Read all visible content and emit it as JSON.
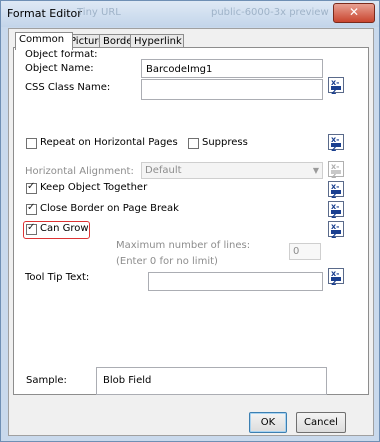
{
  "window": {
    "title": "Format Editor",
    "close_glyph": "✕",
    "background_title_fragments": [
      "Tiny URL",
      "public-6000-3x preview"
    ]
  },
  "tabs": [
    {
      "label": "Common",
      "active": true
    },
    {
      "label": "Picture",
      "active": false
    },
    {
      "label": "Border",
      "active": false
    },
    {
      "label": "Hyperlink",
      "active": false
    }
  ],
  "common": {
    "section_label": "Object format:",
    "object_name_label": "Object Name:",
    "object_name_value": "BarcodeImg1",
    "css_class_label": "CSS Class Name:",
    "css_class_value": "",
    "repeat_label": "Repeat on Horizontal Pages",
    "repeat_checked": false,
    "suppress_label": "Suppress",
    "suppress_checked": false,
    "halign_label": "Horizontal Alignment:",
    "halign_value": "Default",
    "keep_together_label": "Keep Object Together",
    "keep_together_checked": true,
    "close_border_label": "Close Border on Page Break",
    "close_border_checked": true,
    "can_grow_label": "Can Grow",
    "can_grow_checked": true,
    "max_lines_label": "Maximum number of lines:",
    "max_lines_hint": "(Enter 0 for no limit)",
    "max_lines_value": "0",
    "tooltip_label": "Tool Tip Text:",
    "tooltip_value": "",
    "formula_button_glyph": "x-2"
  },
  "sample": {
    "label": "Sample:",
    "value": "Blob Field"
  },
  "buttons": {
    "ok": "OK",
    "cancel": "Cancel"
  },
  "colors": {
    "highlight": "#dd3333",
    "window_border": "#6f8fb4",
    "close_button": "#c9452f"
  }
}
